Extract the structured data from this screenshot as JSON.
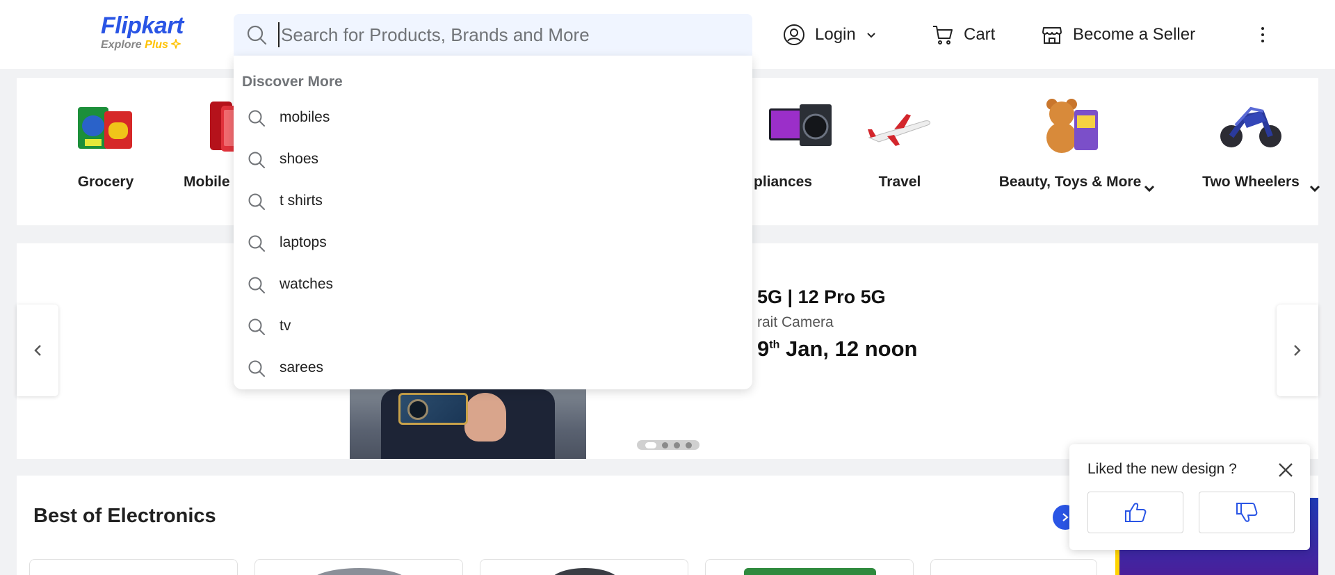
{
  "header": {
    "logo": {
      "title": "Flipkart",
      "tagline_text": "Explore",
      "tagline_plus": "Plus"
    },
    "search": {
      "placeholder": "Search for Products, Brands and More",
      "value": ""
    },
    "login_label": "Login",
    "cart_label": "Cart",
    "seller_label": "Become a Seller"
  },
  "search_dropdown": {
    "title": "Discover More",
    "suggestions": [
      "mobiles",
      "shoes",
      "t shirts",
      "laptops",
      "watches",
      "tv",
      "sarees"
    ]
  },
  "categories": [
    {
      "label": "Grocery",
      "icon": "grocery-image",
      "has_dropdown": false
    },
    {
      "label": "Mobile",
      "icon": "mobiles-image",
      "has_dropdown": false
    },
    {
      "label": "pliances",
      "icon": "appliances-image",
      "has_dropdown": false
    },
    {
      "label": "Travel",
      "icon": "airplane-image",
      "has_dropdown": false
    },
    {
      "label": "Beauty, Toys & More",
      "icon": "teddy-bear-image",
      "has_dropdown": true
    },
    {
      "label": "Two Wheelers",
      "icon": "motorbike-image",
      "has_dropdown": true
    }
  ],
  "banner": {
    "title": "5G | 12 Pro 5G",
    "subtitle": "rait Camera",
    "date_prefix": "9",
    "date_sup": "th",
    "date_suffix": " Jan, 12 noon",
    "slides_total": 4,
    "active_slide": 1
  },
  "electronics": {
    "title": "Best of Electronics"
  },
  "feedback": {
    "question": "Liked the new design ?"
  },
  "colors": {
    "brand": "#2a55e5",
    "accent_yellow": "#ffc200",
    "search_bg": "#f0f5ff",
    "page_bg": "#f1f2f4"
  }
}
